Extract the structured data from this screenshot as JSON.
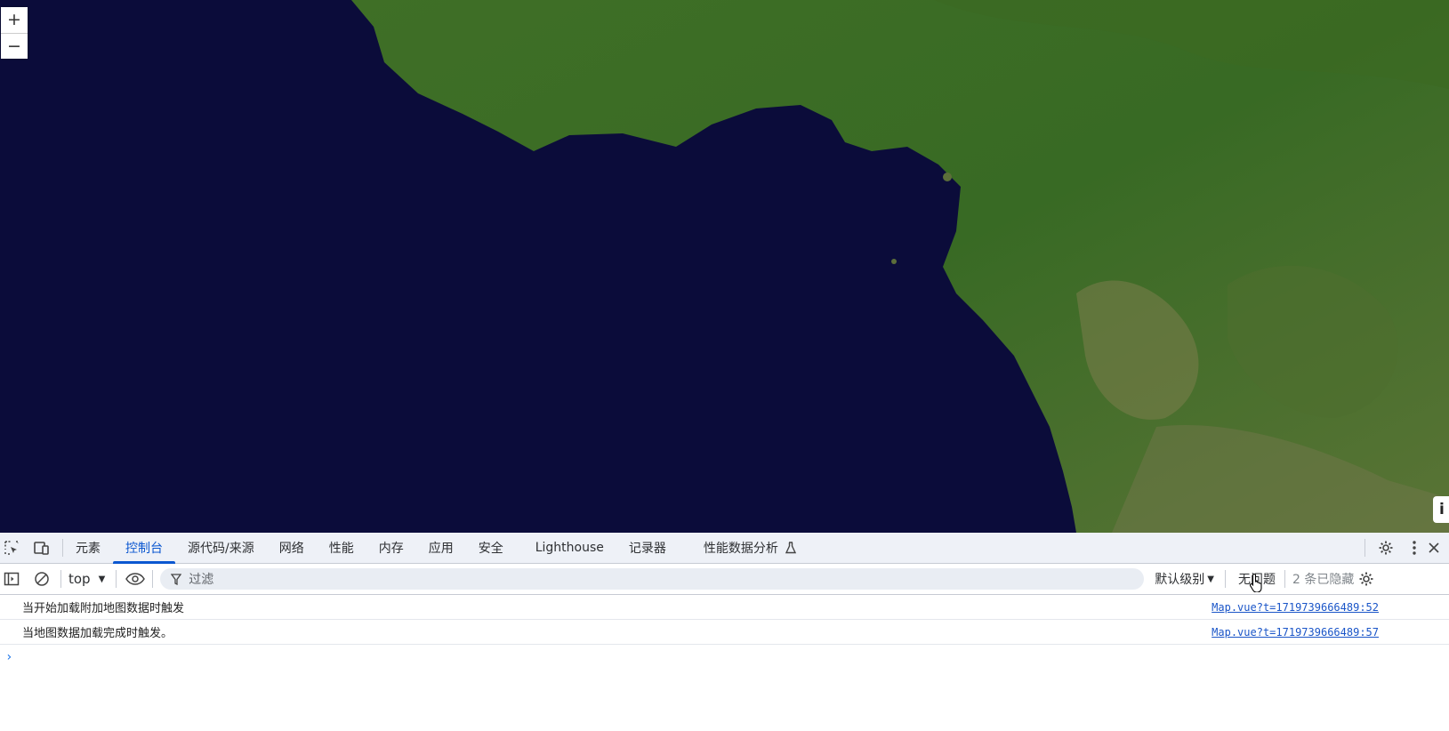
{
  "map": {
    "zoom_in_label": "+",
    "zoom_out_label": "−",
    "attribution_label": "i",
    "colors": {
      "ocean": "#0b0c3a",
      "land": "#3f6b26"
    }
  },
  "devtools": {
    "tabs": [
      {
        "label": "元素"
      },
      {
        "label": "控制台",
        "active": true
      },
      {
        "label": "源代码/来源"
      },
      {
        "label": "网络"
      },
      {
        "label": "性能"
      },
      {
        "label": "内存"
      },
      {
        "label": "应用"
      },
      {
        "label": "安全"
      },
      {
        "label": "Lighthouse"
      },
      {
        "label": "记录器"
      },
      {
        "label": "性能数据分析"
      }
    ],
    "toolbar": {
      "context": "top",
      "filter_placeholder": "过滤",
      "level": "默认级别",
      "issues": "无问题",
      "hidden_count": "2 条已隐藏"
    },
    "messages": [
      {
        "text": "当开始加载附加地图数据时触发",
        "source": "Map.vue?t=1719739666489:52"
      },
      {
        "text": "当地图数据加载完成时触发。",
        "source": "Map.vue?t=1719739666489:57"
      }
    ],
    "prompt_symbol": "›",
    "accent_color": "#0b57d0"
  }
}
